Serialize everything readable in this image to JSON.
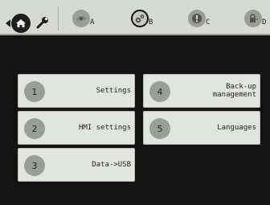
{
  "toolbar": {
    "home_icon": "home-icon",
    "settings_icon": "wrench-icon",
    "nav_left_icon": "left-arrow-icon",
    "status": [
      {
        "letter": "A",
        "icon": "eye-icon"
      },
      {
        "letter": "B",
        "icon": "gears-icon"
      },
      {
        "letter": "C",
        "icon": "alert-icon"
      },
      {
        "letter": "D",
        "icon": "lock-icon"
      }
    ]
  },
  "menu": {
    "items": [
      {
        "number": "1",
        "label": "Settings"
      },
      {
        "number": "2",
        "label": "HMI settings"
      },
      {
        "number": "3",
        "label": "Data->USB"
      },
      {
        "number": "4",
        "label": "Back-up\nmanagement"
      },
      {
        "number": "5",
        "label": "Languages"
      }
    ]
  },
  "colors": {
    "background": "#141414",
    "topbar": "#d7dad4",
    "button": "#e2e4e0",
    "number_circle": "#9a9d98"
  }
}
